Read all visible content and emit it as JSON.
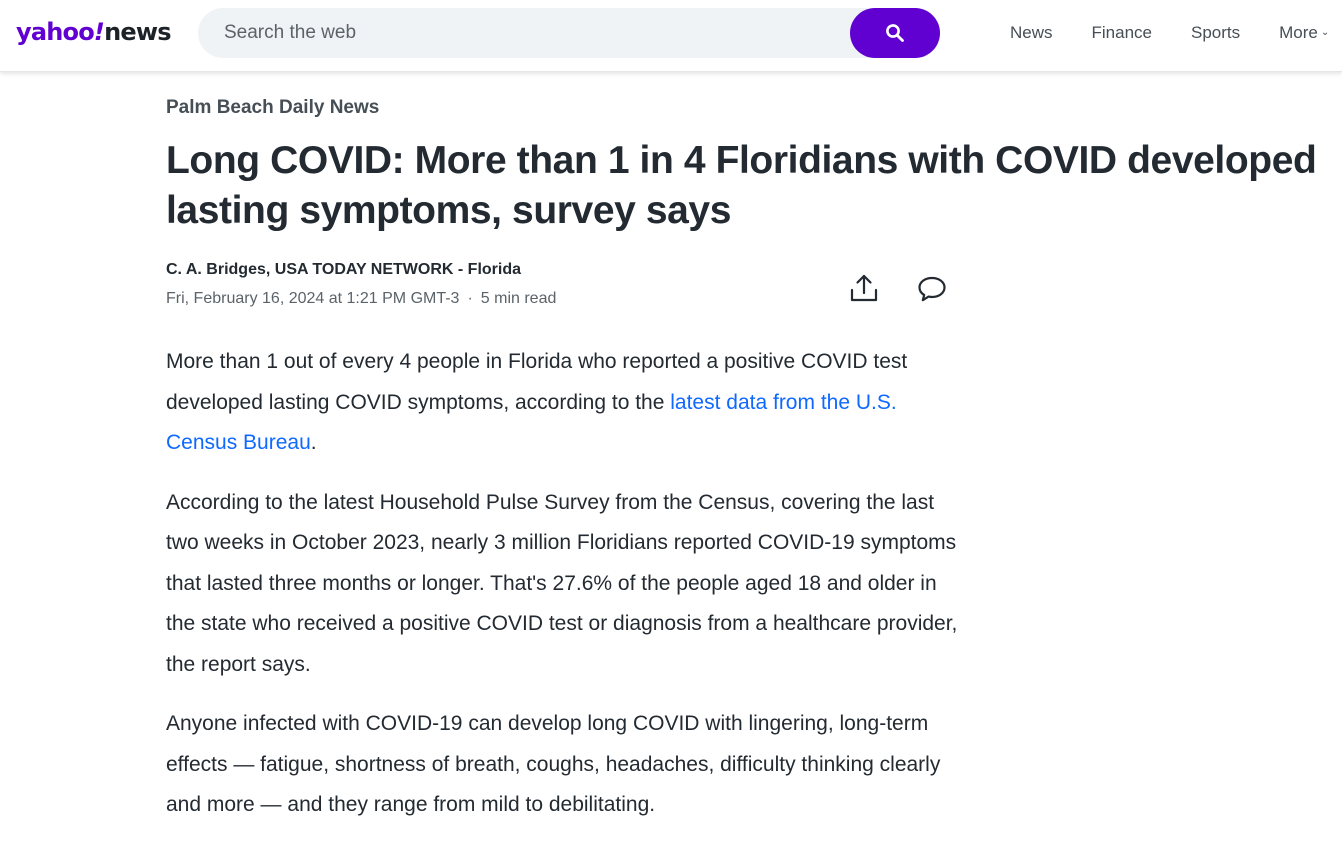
{
  "header": {
    "logo": {
      "brand": "yahoo",
      "bang": "!",
      "section": "news"
    },
    "search": {
      "placeholder": "Search the web",
      "button_icon": "search-icon"
    },
    "nav": [
      {
        "label": "News"
      },
      {
        "label": "Finance"
      },
      {
        "label": "Sports"
      },
      {
        "label": "More"
      }
    ]
  },
  "article": {
    "provider": "Palm Beach Daily News",
    "headline": "Long COVID: More than 1 in 4 Floridians with COVID developed lasting symptoms, survey says",
    "author": "C. A. Bridges, USA TODAY NETWORK - Florida",
    "date": "Fri, February 16, 2024 at 1:21 PM GMT-3",
    "separator": "·",
    "read_time": "5 min read",
    "actions": {
      "share_icon": "share-icon",
      "comment_icon": "comment-icon"
    },
    "paragraphs": [
      {
        "before": "More than 1 out of every 4 people in Florida who reported a positive COVID test developed lasting COVID symptoms, according to the ",
        "link": "latest data from the U.S. Census Bureau",
        "after": "."
      },
      {
        "text": "According to the latest Household Pulse Survey from the Census, covering the last two weeks in October 2023, nearly 3 million Floridians reported COVID-19 symptoms that lasted three months or longer. That's 27.6% of the people aged 18 and older in the state who received a positive COVID test or diagnosis from a healthcare provider, the report says."
      },
      {
        "text": "Anyone infected with COVID-19 can develop long COVID with lingering, long-term effects — fatigue, shortness of breath, coughs, headaches, difficulty thinking clearly and more — and they range from mild to debilitating."
      }
    ]
  },
  "colors": {
    "brand_purple": "#6001d2",
    "link_blue": "#0f69ff",
    "text_dark": "#232a31",
    "text_muted": "#5b636a"
  }
}
